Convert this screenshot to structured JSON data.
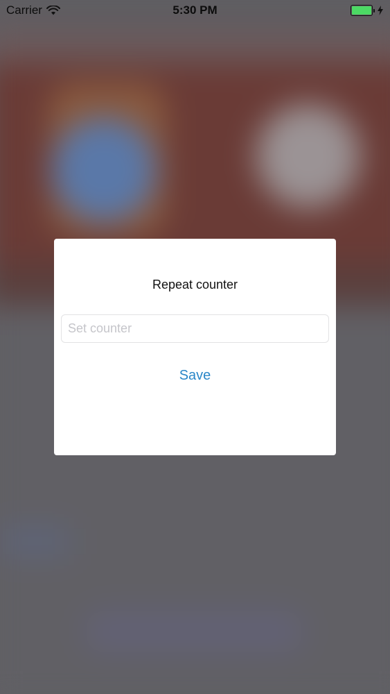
{
  "status_bar": {
    "carrier": "Carrier",
    "time": "5:30 PM",
    "icons": {
      "wifi": "wifi-icon",
      "battery": "battery-icon",
      "charging": "bolt-icon"
    },
    "battery_level": 1.0
  },
  "dialog": {
    "title": "Repeat counter",
    "input": {
      "placeholder": "Set counter",
      "value": ""
    },
    "save_label": "Save"
  },
  "colors": {
    "accent": "#2b87c8",
    "battery_green": "#4cd964",
    "overlay": "#5f5e62"
  }
}
